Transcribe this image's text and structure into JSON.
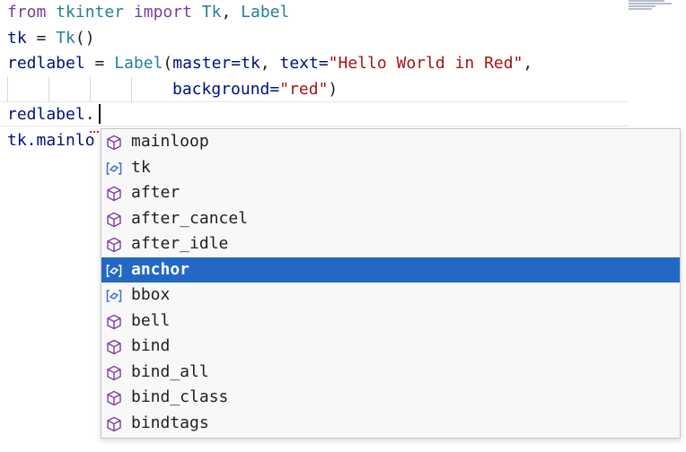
{
  "code": {
    "line1": {
      "from": "from",
      "module": "tkinter",
      "import": "import",
      "tk": "Tk",
      "comma": ",",
      "label": "Label"
    },
    "line2": {
      "var": "tk",
      "eq": " = ",
      "call": "Tk",
      "parens": "()"
    },
    "line3": {
      "var": "redlabel",
      "eq": " = ",
      "cls": "Label",
      "open": "(",
      "master_kw": "master=tk",
      "comma": ", ",
      "text_kw": "text=",
      "text_val": "\"Hello World in Red\"",
      "comma2": ","
    },
    "line4": {
      "bg_kw": "background=",
      "bg_val": "\"red\"",
      "close": ")"
    },
    "line5": {
      "var": "redlabel",
      "dot": "."
    },
    "line6": {
      "text": "tk.mainlo"
    }
  },
  "suggestions": [
    {
      "label": "mainloop",
      "kind": "method"
    },
    {
      "label": "tk",
      "kind": "field"
    },
    {
      "label": "after",
      "kind": "method"
    },
    {
      "label": "after_cancel",
      "kind": "method"
    },
    {
      "label": "after_idle",
      "kind": "method"
    },
    {
      "label": "anchor",
      "kind": "field",
      "selected": true
    },
    {
      "label": "bbox",
      "kind": "field"
    },
    {
      "label": "bell",
      "kind": "method"
    },
    {
      "label": "bind",
      "kind": "method"
    },
    {
      "label": "bind_all",
      "kind": "method"
    },
    {
      "label": "bind_class",
      "kind": "method"
    },
    {
      "label": "bindtags",
      "kind": "method"
    }
  ],
  "colors": {
    "selection": "#2368c4",
    "method_icon": "#7a3e9d",
    "field_icon": "#4a6fc4",
    "keyword": "#7a3e9d",
    "class": "#267f99",
    "string": "#a31515"
  }
}
